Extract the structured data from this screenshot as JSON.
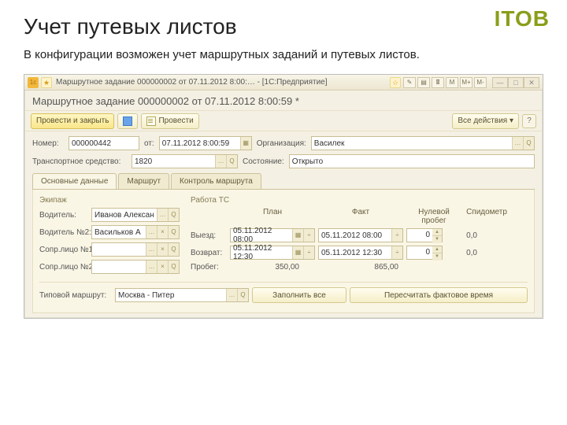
{
  "brand": "ITOB",
  "slide_title": "Учет путевых листов",
  "slide_sub": "В конфигурации возможен учет маршрутных заданий и путевых листов.",
  "titlebar": {
    "text": "Маршрутное задание 000000002 от 07.11.2012 8:00:… - [1С:Предприятие]",
    "btns": [
      "☆",
      "✎",
      "▤",
      "🖩",
      "M",
      "M+",
      "M-"
    ]
  },
  "doc_title": "Маршрутное задание 000000002 от 07.11.2012 8:00:59 *",
  "toolbar": {
    "post_close": "Провести и закрыть",
    "post": "Провести",
    "all_actions": "Все действия ▾"
  },
  "head": {
    "num_label": "Номер:",
    "num": "000000442",
    "date_label": "от:",
    "date": "07.11.2012 8:00:59",
    "org_label": "Организация:",
    "org": "Василек",
    "ts_label": "Транспортное средство:",
    "ts": "1820",
    "status_label": "Состояние:",
    "status": "Открыто"
  },
  "tabs": [
    "Основные данные",
    "Маршрут",
    "Контроль маршрута"
  ],
  "crew": {
    "header": "Экипаж",
    "driver_label": "Водитель:",
    "driver": "Иванов Алексан",
    "driver2_label": "Водитель №2:",
    "driver2": "Васильков А",
    "aide1_label": "Сопр.лицо №1:",
    "aide2_label": "Сопр.лицо №2:"
  },
  "work": {
    "header": "Работа ТС",
    "plan": "План",
    "fact": "Факт",
    "zero": "Нулевой пробег",
    "odo": "Спидометр",
    "out_label": "Выезд:",
    "out_plan": "05.11.2012 08:00",
    "out_fact": "05.11.2012 08:00",
    "out_zero": "0",
    "out_odo": "0,0",
    "in_label": "Возврат:",
    "in_plan": "05.11.2012 12:30",
    "in_fact": "05.11.2012 12:30",
    "in_zero": "0",
    "in_odo": "0,0",
    "run_label": "Пробег:",
    "run_plan": "350,00",
    "run_fact": "865,00"
  },
  "bottom": {
    "route_label": "Типовой маршрут:",
    "route": "Москва - Питер",
    "fill_all": "Заполнить все",
    "recalc": "Пересчитать фактовое время"
  }
}
